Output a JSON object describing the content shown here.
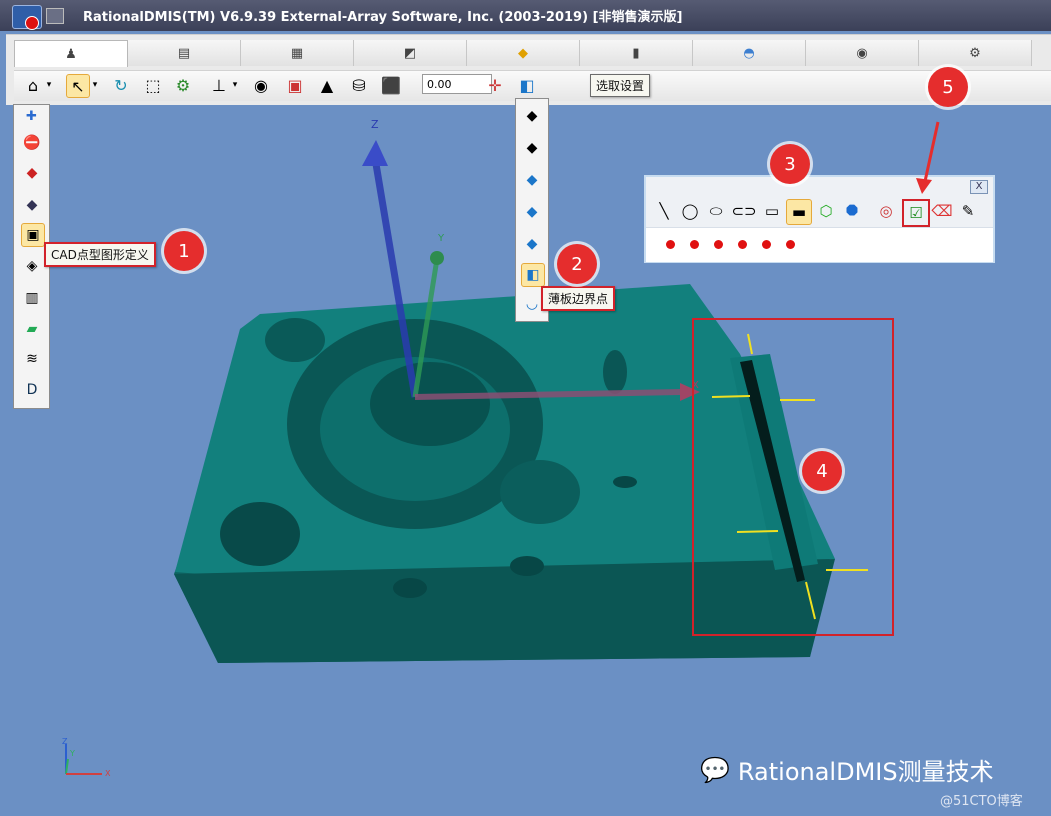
{
  "window": {
    "title": "RationalDMIS(TM) V6.9.39   External-Array Software, Inc. (2003-2019) [非销售演示版]"
  },
  "tabs": [
    {
      "icon": "probe-icon"
    },
    {
      "icon": "document-icon"
    },
    {
      "icon": "grid-icon"
    },
    {
      "icon": "measure-icon"
    },
    {
      "icon": "palette-icon"
    },
    {
      "icon": "camera-icon"
    },
    {
      "icon": "shield-icon"
    },
    {
      "icon": "eye-icon"
    },
    {
      "icon": "settings-icon"
    }
  ],
  "toolbar": {
    "value_field": "0.00",
    "tooltip": "选取设置"
  },
  "left_toolbar": {
    "tooltip": "CAD点型图形定义",
    "items": [
      "cursor-no-icon",
      "cursor-red-icon",
      "cursor-cube-icon",
      "cursor-selected-icon",
      "cursor-layer-icon",
      "cursor-slot-icon",
      "cursor-plane-icon",
      "cursor-stack-icon",
      "cursor-d-icon"
    ]
  },
  "dropdown": {
    "tooltip": "薄板边界点",
    "items": [
      "cube-pick-icon",
      "cube-edge-icon",
      "cube-face-icon",
      "cube-point-icon",
      "cube-vector-icon",
      "thin-plate-icon",
      "curve-icon"
    ]
  },
  "feature_panel": {
    "close_label": "X",
    "icons": [
      "line-icon",
      "circle-icon",
      "ellipse-icon",
      "slot-icon",
      "round-slot-icon",
      "rect-slot-icon",
      "hex-6-icon",
      "oct-8-icon",
      "gauge-icon",
      "check-icon",
      "eraser-icon",
      "edit-icon"
    ],
    "points": 6
  },
  "viewport": {
    "axis_z": "Z",
    "axis_y": "Y",
    "axis_x": "X",
    "mini_axis": {
      "x": "X",
      "y": "Y",
      "z": "Z"
    }
  },
  "annotations": [
    "1",
    "2",
    "3",
    "4",
    "5"
  ],
  "watermark": {
    "text": "RationalDMIS测量技术",
    "credit": "@51CTO博客"
  },
  "colors": {
    "part": "#0f6b69",
    "background": "#6b90c4",
    "accent": "#d2222a"
  }
}
